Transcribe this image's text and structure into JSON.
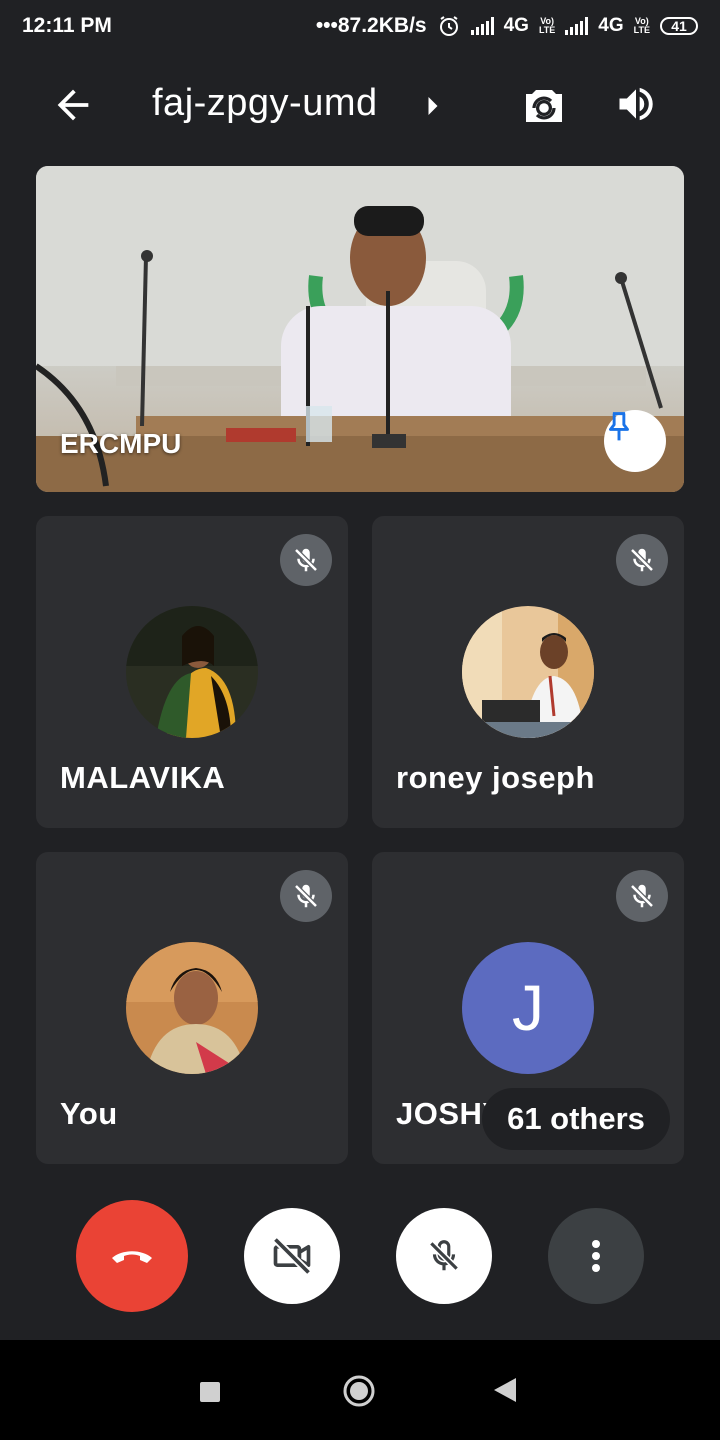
{
  "status_bar": {
    "time": "12:11 PM",
    "network_speed": "•••87.2KB/s",
    "sim1_label": "4G",
    "sim1_volte": "Vo)\nLTE",
    "sim2_label": "4G",
    "sim2_volte": "Vo)\nLTE",
    "battery_level": "41"
  },
  "app_bar": {
    "meeting_code": "faj-zpgy-umd"
  },
  "pinned_tile": {
    "name": "ERCMPU"
  },
  "participants": [
    {
      "name": "MALAVIKA",
      "muted": true
    },
    {
      "name": "roney joseph",
      "muted": true
    },
    {
      "name": "You",
      "muted": true
    },
    {
      "name": "JOSHY",
      "avatar_letter": "J",
      "avatar_color": "#5c6bc0",
      "muted": true
    }
  ],
  "others_pill": "61 others",
  "colors": {
    "background": "#202124",
    "tile": "#2d2e31",
    "end_call": "#ea4335",
    "pin_icon": "#1a73e8"
  }
}
